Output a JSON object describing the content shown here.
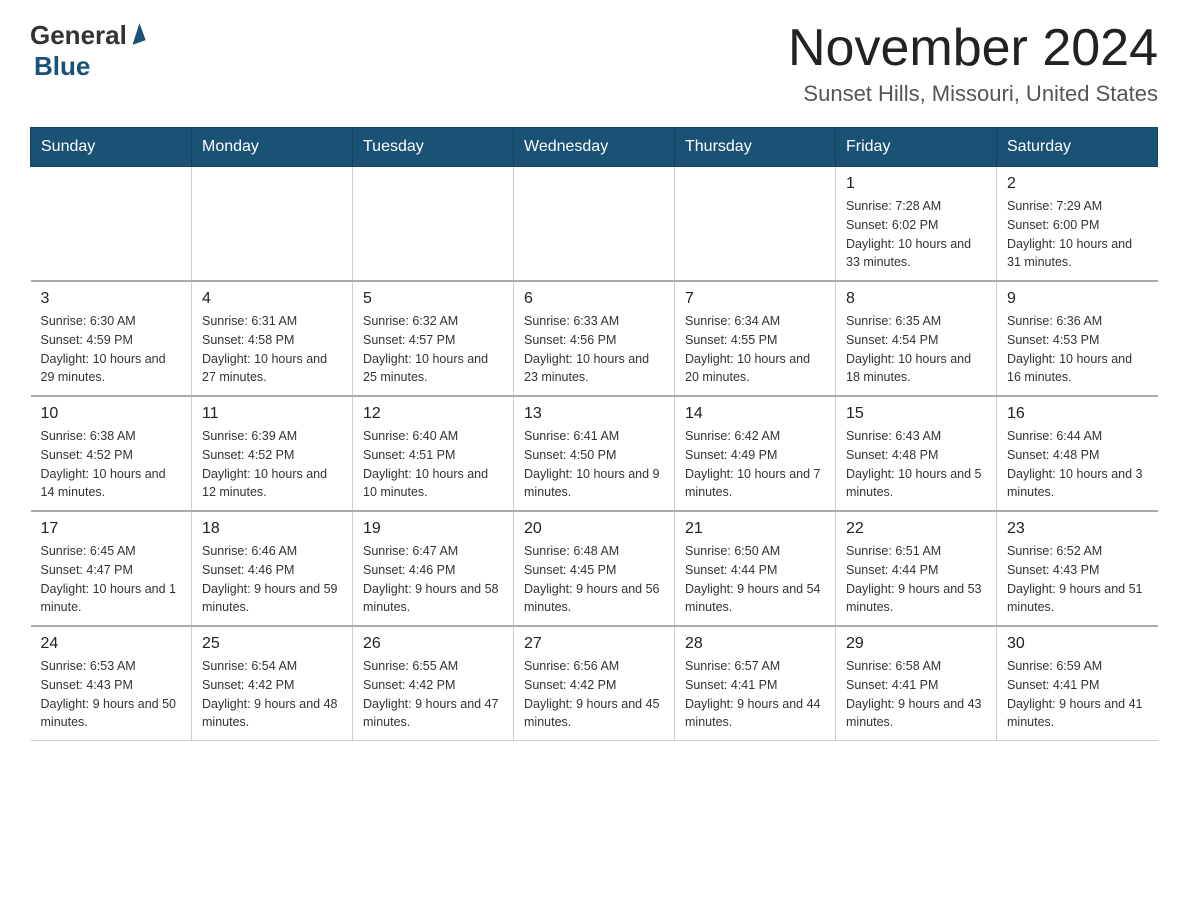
{
  "logo": {
    "general": "General",
    "blue": "Blue"
  },
  "title": "November 2024",
  "subtitle": "Sunset Hills, Missouri, United States",
  "weekdays": [
    "Sunday",
    "Monday",
    "Tuesday",
    "Wednesday",
    "Thursday",
    "Friday",
    "Saturday"
  ],
  "weeks": [
    [
      {
        "day": "",
        "info": ""
      },
      {
        "day": "",
        "info": ""
      },
      {
        "day": "",
        "info": ""
      },
      {
        "day": "",
        "info": ""
      },
      {
        "day": "",
        "info": ""
      },
      {
        "day": "1",
        "info": "Sunrise: 7:28 AM\nSunset: 6:02 PM\nDaylight: 10 hours\nand 33 minutes."
      },
      {
        "day": "2",
        "info": "Sunrise: 7:29 AM\nSunset: 6:00 PM\nDaylight: 10 hours\nand 31 minutes."
      }
    ],
    [
      {
        "day": "3",
        "info": "Sunrise: 6:30 AM\nSunset: 4:59 PM\nDaylight: 10 hours\nand 29 minutes."
      },
      {
        "day": "4",
        "info": "Sunrise: 6:31 AM\nSunset: 4:58 PM\nDaylight: 10 hours\nand 27 minutes."
      },
      {
        "day": "5",
        "info": "Sunrise: 6:32 AM\nSunset: 4:57 PM\nDaylight: 10 hours\nand 25 minutes."
      },
      {
        "day": "6",
        "info": "Sunrise: 6:33 AM\nSunset: 4:56 PM\nDaylight: 10 hours\nand 23 minutes."
      },
      {
        "day": "7",
        "info": "Sunrise: 6:34 AM\nSunset: 4:55 PM\nDaylight: 10 hours\nand 20 minutes."
      },
      {
        "day": "8",
        "info": "Sunrise: 6:35 AM\nSunset: 4:54 PM\nDaylight: 10 hours\nand 18 minutes."
      },
      {
        "day": "9",
        "info": "Sunrise: 6:36 AM\nSunset: 4:53 PM\nDaylight: 10 hours\nand 16 minutes."
      }
    ],
    [
      {
        "day": "10",
        "info": "Sunrise: 6:38 AM\nSunset: 4:52 PM\nDaylight: 10 hours\nand 14 minutes."
      },
      {
        "day": "11",
        "info": "Sunrise: 6:39 AM\nSunset: 4:52 PM\nDaylight: 10 hours\nand 12 minutes."
      },
      {
        "day": "12",
        "info": "Sunrise: 6:40 AM\nSunset: 4:51 PM\nDaylight: 10 hours\nand 10 minutes."
      },
      {
        "day": "13",
        "info": "Sunrise: 6:41 AM\nSunset: 4:50 PM\nDaylight: 10 hours\nand 9 minutes."
      },
      {
        "day": "14",
        "info": "Sunrise: 6:42 AM\nSunset: 4:49 PM\nDaylight: 10 hours\nand 7 minutes."
      },
      {
        "day": "15",
        "info": "Sunrise: 6:43 AM\nSunset: 4:48 PM\nDaylight: 10 hours\nand 5 minutes."
      },
      {
        "day": "16",
        "info": "Sunrise: 6:44 AM\nSunset: 4:48 PM\nDaylight: 10 hours\nand 3 minutes."
      }
    ],
    [
      {
        "day": "17",
        "info": "Sunrise: 6:45 AM\nSunset: 4:47 PM\nDaylight: 10 hours\nand 1 minute."
      },
      {
        "day": "18",
        "info": "Sunrise: 6:46 AM\nSunset: 4:46 PM\nDaylight: 9 hours\nand 59 minutes."
      },
      {
        "day": "19",
        "info": "Sunrise: 6:47 AM\nSunset: 4:46 PM\nDaylight: 9 hours\nand 58 minutes."
      },
      {
        "day": "20",
        "info": "Sunrise: 6:48 AM\nSunset: 4:45 PM\nDaylight: 9 hours\nand 56 minutes."
      },
      {
        "day": "21",
        "info": "Sunrise: 6:50 AM\nSunset: 4:44 PM\nDaylight: 9 hours\nand 54 minutes."
      },
      {
        "day": "22",
        "info": "Sunrise: 6:51 AM\nSunset: 4:44 PM\nDaylight: 9 hours\nand 53 minutes."
      },
      {
        "day": "23",
        "info": "Sunrise: 6:52 AM\nSunset: 4:43 PM\nDaylight: 9 hours\nand 51 minutes."
      }
    ],
    [
      {
        "day": "24",
        "info": "Sunrise: 6:53 AM\nSunset: 4:43 PM\nDaylight: 9 hours\nand 50 minutes."
      },
      {
        "day": "25",
        "info": "Sunrise: 6:54 AM\nSunset: 4:42 PM\nDaylight: 9 hours\nand 48 minutes."
      },
      {
        "day": "26",
        "info": "Sunrise: 6:55 AM\nSunset: 4:42 PM\nDaylight: 9 hours\nand 47 minutes."
      },
      {
        "day": "27",
        "info": "Sunrise: 6:56 AM\nSunset: 4:42 PM\nDaylight: 9 hours\nand 45 minutes."
      },
      {
        "day": "28",
        "info": "Sunrise: 6:57 AM\nSunset: 4:41 PM\nDaylight: 9 hours\nand 44 minutes."
      },
      {
        "day": "29",
        "info": "Sunrise: 6:58 AM\nSunset: 4:41 PM\nDaylight: 9 hours\nand 43 minutes."
      },
      {
        "day": "30",
        "info": "Sunrise: 6:59 AM\nSunset: 4:41 PM\nDaylight: 9 hours\nand 41 minutes."
      }
    ]
  ]
}
